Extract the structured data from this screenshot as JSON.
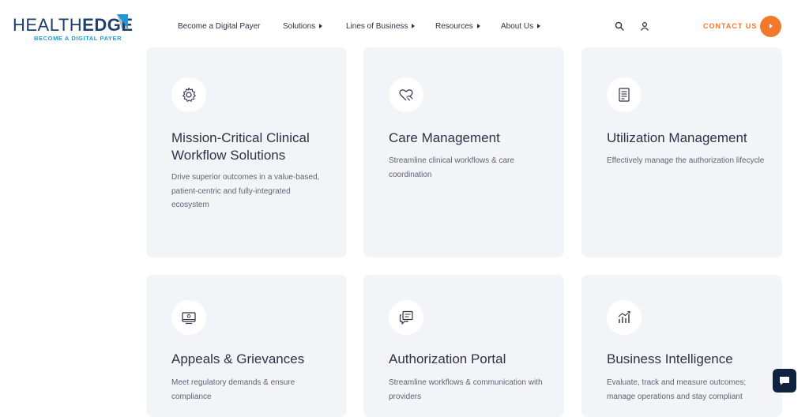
{
  "header": {
    "logo": {
      "word_light": "HEALTH",
      "word_bold": "EDGE",
      "tagline": "BECOME A DIGITAL PAYER"
    },
    "nav": [
      {
        "label": "Become a Digital Payer",
        "has_caret": false
      },
      {
        "label": "Solutions",
        "has_caret": true
      },
      {
        "label": "Lines of Business",
        "has_caret": true
      },
      {
        "label": "Resources",
        "has_caret": true
      },
      {
        "label": "About Us",
        "has_caret": true
      }
    ],
    "search_icon": "search-icon",
    "account_icon": "user-icon",
    "contact_label": "CONTACT US",
    "accent_color": "#f4782a",
    "brand_color": "#1f3f6e"
  },
  "cards": [
    {
      "icon": "gear-icon",
      "title": "Mission-Critical Clinical Workflow Solutions",
      "description": "Drive superior outcomes in a value-based, patient-centric and fully-integrated ecosystem"
    },
    {
      "icon": "heart-hand-icon",
      "title": "Care Management",
      "description": "Streamline clinical workflows & care coordination"
    },
    {
      "icon": "document-icon",
      "title": "Utilization Management",
      "description": "Effectively manage the authorization lifecycle"
    },
    {
      "icon": "monitor-icon",
      "title": "Appeals & Grievances",
      "description": "Meet regulatory demands & ensure compliance"
    },
    {
      "icon": "chat-document-icon",
      "title": "Authorization Portal",
      "description": "Streamline workflows & communication with providers"
    },
    {
      "icon": "chart-icon",
      "title": "Business Intelligence",
      "description": "Evaluate, track and measure outcomes; manage operations and stay compliant"
    }
  ],
  "chat_widget": {
    "icon": "chat-bubble-icon",
    "color": "#0e2340"
  }
}
